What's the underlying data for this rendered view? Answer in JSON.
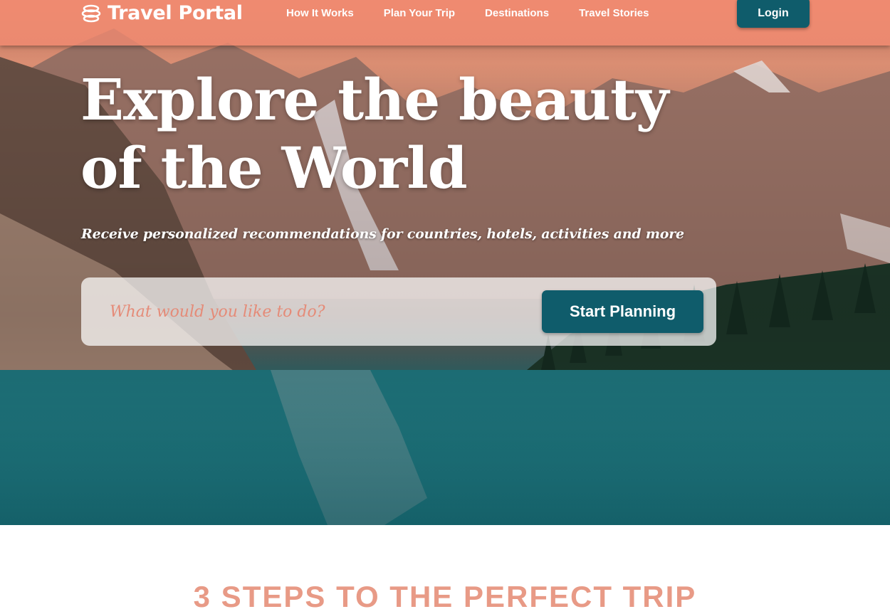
{
  "brand": {
    "name": "Travel Portal",
    "logo_icon": "globe-stack-icon"
  },
  "nav": {
    "links": [
      {
        "label": "How It Works"
      },
      {
        "label": "Plan Your Trip"
      },
      {
        "label": "Destinations"
      },
      {
        "label": "Travel Stories"
      }
    ],
    "login_label": "Login"
  },
  "hero": {
    "headline": "Explore the beauty of the World",
    "subtitle": "Receive personalized recommendations for countries, hotels, activities and more",
    "search": {
      "placeholder": "What would you like to do?",
      "button_label": "Start Planning"
    }
  },
  "section": {
    "title": "3 STEPS TO THE PERFECT TRIP"
  },
  "colors": {
    "navbar": "#f28b71",
    "primary_button": "#0f5c6b",
    "accent": "#e58b78"
  }
}
